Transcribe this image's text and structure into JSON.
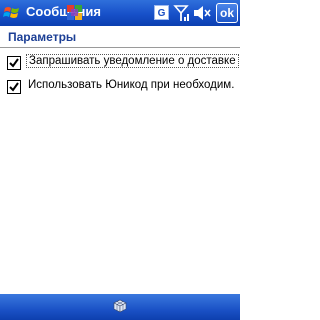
{
  "titlebar": {
    "title": "Сообщения",
    "status_g": "G",
    "ok_label": "ok",
    "icons": [
      "windows-start-icon",
      "notification-icon",
      "signal-icon",
      "volume-icon"
    ]
  },
  "page": {
    "title": "Параметры"
  },
  "options": [
    {
      "label": "Запрашивать уведомление о доставке",
      "checked": true,
      "focused": true
    },
    {
      "label": "Использовать Юникод при необходим.",
      "checked": true,
      "focused": false
    }
  ],
  "menubar": {
    "icons": [
      "keyboard-icon"
    ]
  },
  "colors": {
    "titlebar": "#1750c9",
    "accent_text": "#1c3f95",
    "background": "#ffffff"
  }
}
